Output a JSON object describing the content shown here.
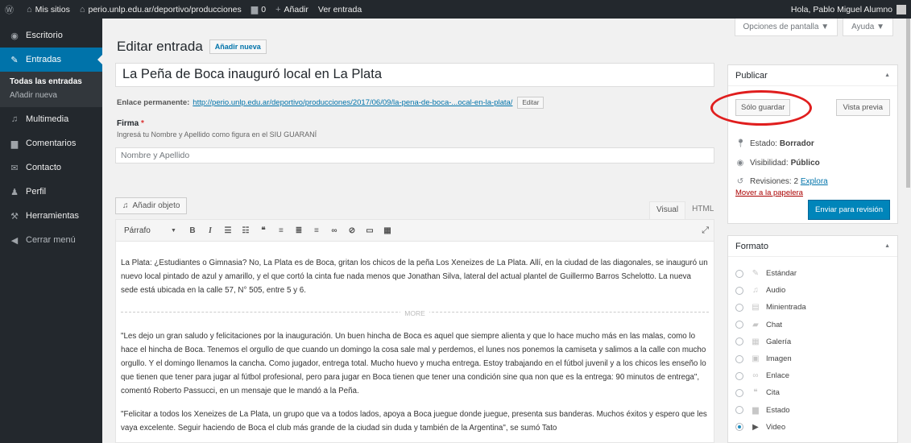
{
  "adminbar": {
    "wp_icon": "wordpress-icon",
    "my_sites": "Mis sitios",
    "site_name": "perio.unlp.edu.ar/deportivo/producciones",
    "comments_count": "0",
    "add_new": "Añadir",
    "view_entry": "Ver entrada",
    "greeting": "Hola, Pablo Miguel Alumno"
  },
  "sidebar": {
    "items": [
      {
        "label": "Escritorio",
        "icon": "dashboard-icon"
      },
      {
        "label": "Entradas",
        "icon": "pin-icon"
      },
      {
        "label": "Multimedia",
        "icon": "media-icon"
      },
      {
        "label": "Comentarios",
        "icon": "comments-icon"
      },
      {
        "label": "Contacto",
        "icon": "mail-icon"
      },
      {
        "label": "Perfil",
        "icon": "user-icon"
      },
      {
        "label": "Herramientas",
        "icon": "wrench-icon"
      },
      {
        "label": "Cerrar menú",
        "icon": "collapse-icon"
      }
    ],
    "submenu": [
      "Todas las entradas",
      "Añadir nueva"
    ]
  },
  "screen_meta": {
    "options": "Opciones de pantalla ▼",
    "help": "Ayuda ▼"
  },
  "page": {
    "title": "Editar entrada",
    "add_new": "Añadir nueva",
    "post_title": "La Peña de Boca inauguró local en La Plata",
    "permalink_label": "Enlace permanente:",
    "permalink_url": "http://perio.unlp.edu.ar/deportivo/producciones/2017/06/09/la-pena-de-boca-...ocal-en-la-plata/",
    "permalink_edit": "Editar",
    "firma_label": "Firma",
    "firma_required": "*",
    "firma_desc": "Ingresá tu Nombre y Apellido como figura en el SIU GUARANÍ",
    "firma_placeholder": "Nombre y Apellido"
  },
  "editor": {
    "add_media": "Añadir objeto",
    "tab_visual": "Visual",
    "tab_html": "HTML",
    "format_select": "Párrafo",
    "more_label": "MORE",
    "paragraphs": [
      "La Plata: ¿Estudiantes o Gimnasia? No, La Plata es de Boca, gritan los chicos de la peña Los Xeneizes de La Plata. Allí, en la ciudad de las diagonales, se inauguró un nuevo local pintado de azul y amarillo, y el que cortó la cinta fue nada menos que Jonathan Silva, lateral del actual plantel de Guillermo Barros Schelotto. La nueva sede está ubicada en la calle 57, N° 505, entre 5 y 6.",
      "\"Les dejo un gran saludo y felicitaciones por la inauguración. Un buen hincha de Boca es aquel que siempre alienta y que lo hace mucho más en las malas, como lo hace el hincha de Boca. Tenemos el orgullo de que cuando un domingo la cosa sale mal y perdemos, el lunes nos ponemos la camiseta y salimos a la calle con mucho orgullo. Y el domingo llenamos la cancha. Como jugador, entrega total. Mucho huevo y mucha entrega. Estoy trabajando en el fútbol juvenil y a los chicos les enseño lo que tienen que tener para jugar al fútbol profesional, pero para jugar en Boca tienen que tener una condición sine qua non que es la entrega: 90 minutos de entrega\", comentó Roberto Passucci, en un mensaje que le mandó a la Peña.",
      "\"Felicitar a todos los Xeneizes de La Plata, un grupo que va a todos lados, apoya a Boca juegue donde juegue, presenta sus banderas. Muchos éxitos y espero que les vaya excelente. Seguir haciendo de Boca el club más grande de la ciudad sin duda y también de la Argentina\", se sumó Tato"
    ]
  },
  "publish": {
    "title": "Publicar",
    "save_draft": "Sólo guardar",
    "preview": "Vista previa",
    "status_label": "Estado:",
    "status_value": "Borrador",
    "visibility_label": "Visibilidad:",
    "visibility_value": "Público",
    "revisions_label": "Revisiones: 2",
    "revisions_link": "Explora",
    "trash": "Mover a la papelera",
    "submit": "Enviar para revisión"
  },
  "format": {
    "title": "Formato",
    "options": [
      {
        "label": "Estándar",
        "icon": "pin-icon"
      },
      {
        "label": "Audio",
        "icon": "audio-icon"
      },
      {
        "label": "Minientrada",
        "icon": "aside-icon"
      },
      {
        "label": "Chat",
        "icon": "chat-icon"
      },
      {
        "label": "Galería",
        "icon": "gallery-icon"
      },
      {
        "label": "Imagen",
        "icon": "image-icon"
      },
      {
        "label": "Enlace",
        "icon": "link-icon"
      },
      {
        "label": "Cita",
        "icon": "quote-icon"
      },
      {
        "label": "Estado",
        "icon": "status-icon"
      },
      {
        "label": "Video",
        "icon": "video-icon"
      }
    ],
    "selected": "Video"
  },
  "colors": {
    "accent": "#0073aa",
    "sidebar": "#23282d",
    "primary_button": "#0085ba",
    "highlight_ring": "#e01e1e"
  }
}
